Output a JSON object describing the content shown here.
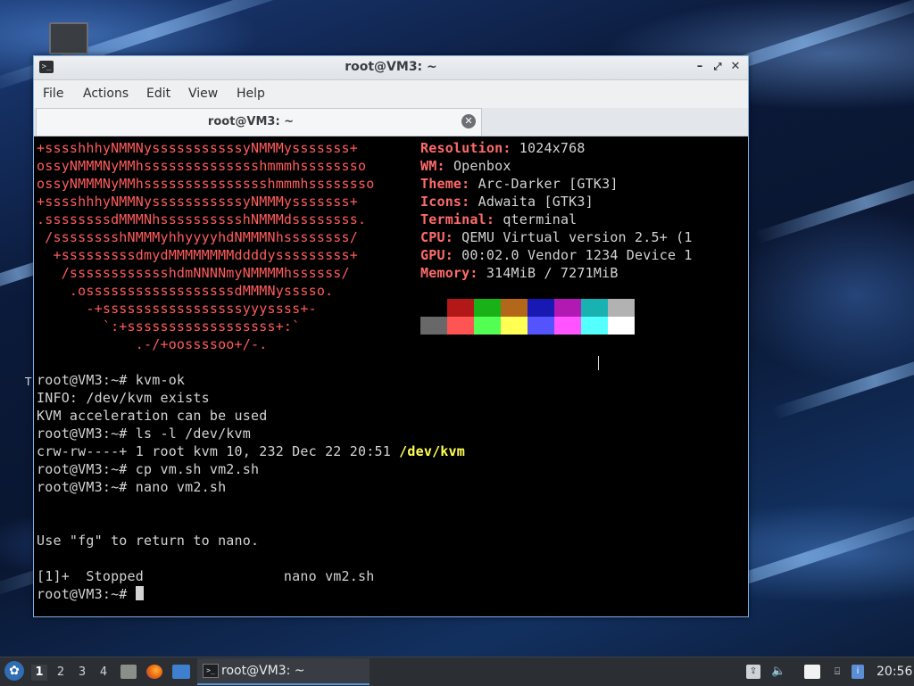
{
  "window": {
    "title": "root@VM3: ~",
    "menu": [
      "File",
      "Actions",
      "Edit",
      "View",
      "Help"
    ],
    "tab_label": "root@VM3: ~"
  },
  "neofetch": {
    "art": [
      "+sssshhhyNMMNysssssssssssyNMMMysssssss+",
      "ossyNMMMNyMMhsssssssssssssshmmmhssssssso",
      "ossyNMMMNyMMhssssssssssssssshmmmhssssssso",
      "+sssshhhyNMMNysssssssssssyNMMMysssssss+",
      ".ssssssssdMMMNhsssssssssshNMMMdssssssss.",
      " /sssssssshNMMMyhhyyyyhdNMMMNhssssssss/",
      "  +sssssssssdmydMMMMMMMMddddysssssssss+",
      "   /sssssssssssshdmNNNNmyNMMMMhssssss/",
      "    .ossssssssssssssssssdMMMNysssso.",
      "      -+sssssssssssssssssyyyssss+-",
      "        `:+ssssssssssssssssss+:`",
      "            .-/+oossssoo+/-."
    ],
    "info": [
      {
        "key": "Resolution",
        "value": "1024x768"
      },
      {
        "key": "WM",
        "value": "Openbox"
      },
      {
        "key": "Theme",
        "value": "Arc-Darker [GTK3]"
      },
      {
        "key": "Icons",
        "value": "Adwaita [GTK3]"
      },
      {
        "key": "Terminal",
        "value": "qterminal"
      },
      {
        "key": "CPU",
        "value": "QEMU Virtual version 2.5+ (1"
      },
      {
        "key": "GPU",
        "value": "00:02.0 Vendor 1234 Device 1"
      },
      {
        "key": "Memory",
        "value": "314MiB / 7271MiB"
      }
    ],
    "palette_top": [
      "#000000",
      "#b21818",
      "#18b218",
      "#b26818",
      "#1818b2",
      "#b218b2",
      "#18b2b2",
      "#b2b2b2"
    ],
    "palette_bottom": [
      "#686868",
      "#ff5454",
      "#54ff54",
      "#ffff54",
      "#5454ff",
      "#ff54ff",
      "#54ffff",
      "#ffffff"
    ]
  },
  "terminal": {
    "lines": [
      "root@VM3:~# kvm-ok",
      "INFO: /dev/kvm exists",
      "KVM acceleration can be used",
      "root@VM3:~# ls -l /dev/kvm",
      "crw-rw----+ 1 root kvm 10, 232 Dec 22 20:51 ",
      "root@VM3:~# cp vm.sh vm2.sh",
      "root@VM3:~# nano vm2.sh",
      "",
      "",
      "Use \"fg\" to return to nano.",
      "",
      "[1]+  Stopped                 nano vm2.sh",
      "root@VM3:~# "
    ],
    "highlight_path": "/dev/kvm"
  },
  "desktop": {
    "stray_text": "T"
  },
  "taskbar": {
    "workspaces": [
      "1",
      "2",
      "3",
      "4"
    ],
    "active_task": "root@VM3: ~",
    "clock": "20:56"
  },
  "colors": {
    "accent": "#4f93d8",
    "art_red": "#ff5c5c",
    "highlight_yellow": "#ffff55"
  }
}
